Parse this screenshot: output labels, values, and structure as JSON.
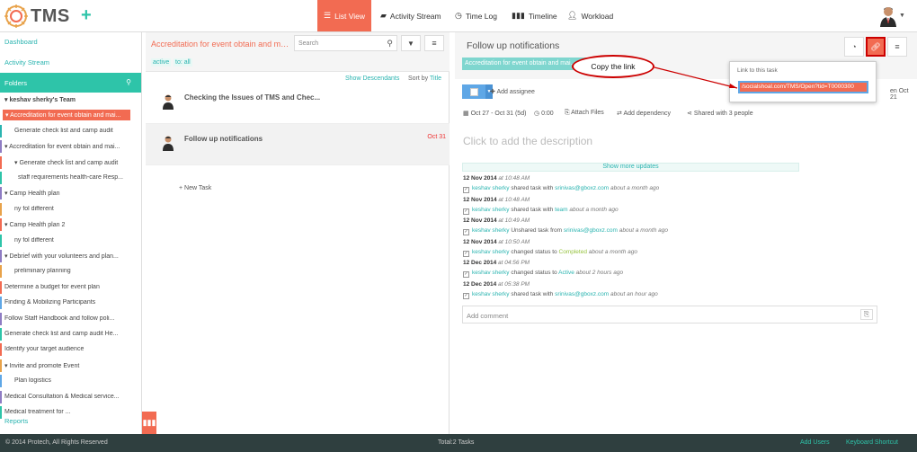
{
  "app": {
    "logo_text": "TMS"
  },
  "nav": {
    "list_view": "List View",
    "activity_stream": "Activity Stream",
    "time_log": "Time Log",
    "timeline": "Timeline",
    "workload": "Workload"
  },
  "sidebar": {
    "dashboard": "Dashboard",
    "activity_stream": "Activity Stream",
    "folders": "Folders",
    "reports": "Reports",
    "tree": [
      {
        "label": "keshav sherky's Team",
        "level": 0,
        "bold": true,
        "caret": true
      },
      {
        "label": "Accreditation for event obtain and mai...",
        "level": 0,
        "active": true,
        "caret": true
      },
      {
        "label": "Generate check list and camp audit",
        "level": 1
      },
      {
        "label": "Accreditation for event obtain and mai...",
        "level": 0,
        "caret": true
      },
      {
        "label": "Generate check list and camp audit",
        "level": 1,
        "caret": true
      },
      {
        "label": "staff requirements health-care Resp...",
        "level": 2
      },
      {
        "label": "Camp Health plan",
        "level": 0,
        "caret": true
      },
      {
        "label": "ny fol different",
        "level": 1
      },
      {
        "label": "Camp Health plan 2",
        "level": 0,
        "caret": true
      },
      {
        "label": "ny fol different",
        "level": 1
      },
      {
        "label": "Debrief with your volunteers and plan...",
        "level": 0,
        "caret": true
      },
      {
        "label": "preliminary planning",
        "level": 1
      },
      {
        "label": "Determine a budget for event plan",
        "level": 0
      },
      {
        "label": "Finding & Mobilizing Participants",
        "level": 0
      },
      {
        "label": "Follow Staff Handbook and follow poli...",
        "level": 0
      },
      {
        "label": "Generate check list and camp audit He...",
        "level": 0
      },
      {
        "label": "Identify your target audience",
        "level": 0
      },
      {
        "label": "Invite and promote Event",
        "level": 0,
        "caret": true
      },
      {
        "label": "Plan logistics",
        "level": 1
      },
      {
        "label": "Medical Consultation & Medical service...",
        "level": 0
      },
      {
        "label": "Medical treatment for ...",
        "level": 0
      }
    ]
  },
  "middle": {
    "title": "Accreditation for event obtain and mai...",
    "search_placeholder": "Search",
    "tag_active": "active",
    "tag_to": "to: all",
    "show_descendants": "Show Descendants",
    "sort_by": "Sort by",
    "sort_field": "Title",
    "tasks": [
      {
        "title": "Checking the Issues of TMS and Chec...",
        "date": ""
      },
      {
        "title": "Follow up notifications",
        "date": "Oct 31"
      }
    ],
    "new_task": "New Task"
  },
  "detail": {
    "title": "Follow up notifications",
    "folder_tag": "Accreditation for event obtain and mai...",
    "add_assignee": "Add assignee",
    "due": "en Oct 21",
    "date_range": "Oct 27 - Oct 31 (5d)",
    "time": "0:00",
    "attach_files": "Attach Files",
    "add_dependency": "Add dependency",
    "shared_with": "Shared with 3 people",
    "description_placeholder": "Click to add the description",
    "show_more": "Show more updates",
    "comment_placeholder": "Add comment",
    "activities": [
      {
        "date": "12 Nov 2014",
        "time": "at 10:48 AM",
        "user": "keshav sherky",
        "action": "shared task with",
        "target": "srinivas@gboxz.com",
        "target_style": "u",
        "ago": "about a month ago"
      },
      {
        "date": "12 Nov 2014",
        "time": "at 10:48 AM",
        "user": "keshav sherky",
        "action": "shared task with",
        "target": "team",
        "target_style": "u",
        "ago": "about a month ago"
      },
      {
        "date": "12 Nov 2014",
        "time": "at 10:49 AM",
        "user": "keshav sherky",
        "action": "Unshared task from",
        "target": "srinivas@gboxz.com",
        "target_style": "u",
        "ago": "about a month ago"
      },
      {
        "date": "12 Nov 2014",
        "time": "at 10:50 AM",
        "user": "keshav sherky",
        "action": "changed status to",
        "target": "Completed",
        "target_style": "g",
        "ago": "about a month ago"
      },
      {
        "date": "12 Dec 2014",
        "time": "at 04:56 PM",
        "user": "keshav sherky",
        "action": "changed status to",
        "target": "Active",
        "target_style": "u",
        "ago": "about 2 hours ago"
      },
      {
        "date": "12 Dec 2014",
        "time": "at 05:38 PM",
        "user": "keshav sherky",
        "action": "shared task with",
        "target": "srinivas@gboxz.com",
        "target_style": "u",
        "ago": "about an hour ago"
      }
    ]
  },
  "popup": {
    "label": "Link to this task",
    "url": "/socialshoal.com/TMS/Open?tid=T0000300"
  },
  "callout": "Copy the link",
  "footer": {
    "copyright": "© 2014 Protech, All Rights Reserved",
    "total": "Total:2 Tasks",
    "add_users": "Add Users",
    "shortcut": "Keyboard Shortcut"
  },
  "colors": {
    "accent": "#f26b52",
    "teal": "#2ec4a9",
    "link": "#2ab4b0",
    "footer": "#2f3f3f"
  },
  "icons": [
    "logo-icon",
    "plus-icon",
    "list-icon",
    "chat-icon",
    "clock-icon",
    "timeline-icon",
    "user-icon",
    "search-icon",
    "filter-icon",
    "menu-icon",
    "rss-icon",
    "link-icon",
    "calendar-icon",
    "timer-icon",
    "paperclip-icon",
    "dependency-icon",
    "share-icon",
    "plus-icon",
    "bars-icon"
  ]
}
